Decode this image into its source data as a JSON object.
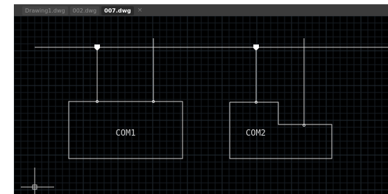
{
  "tabs": [
    {
      "label": "Drawing1.dwg",
      "active": false
    },
    {
      "label": "002.dwg",
      "active": false
    },
    {
      "label": "007.dwg",
      "active": true
    }
  ],
  "tab_close_glyph": "×",
  "drawing": {
    "labels": {
      "com1": "COM1",
      "com2": "COM2"
    }
  },
  "colors": {
    "canvas_bg": "#000000",
    "grid_minor": "#161c22",
    "grid_major": "#222b34",
    "linework": "#d4d4d4",
    "tab_bar": "#3b3b3b",
    "tab_active_text": "#ffffff",
    "tab_inactive_text": "#8f8f8f"
  }
}
